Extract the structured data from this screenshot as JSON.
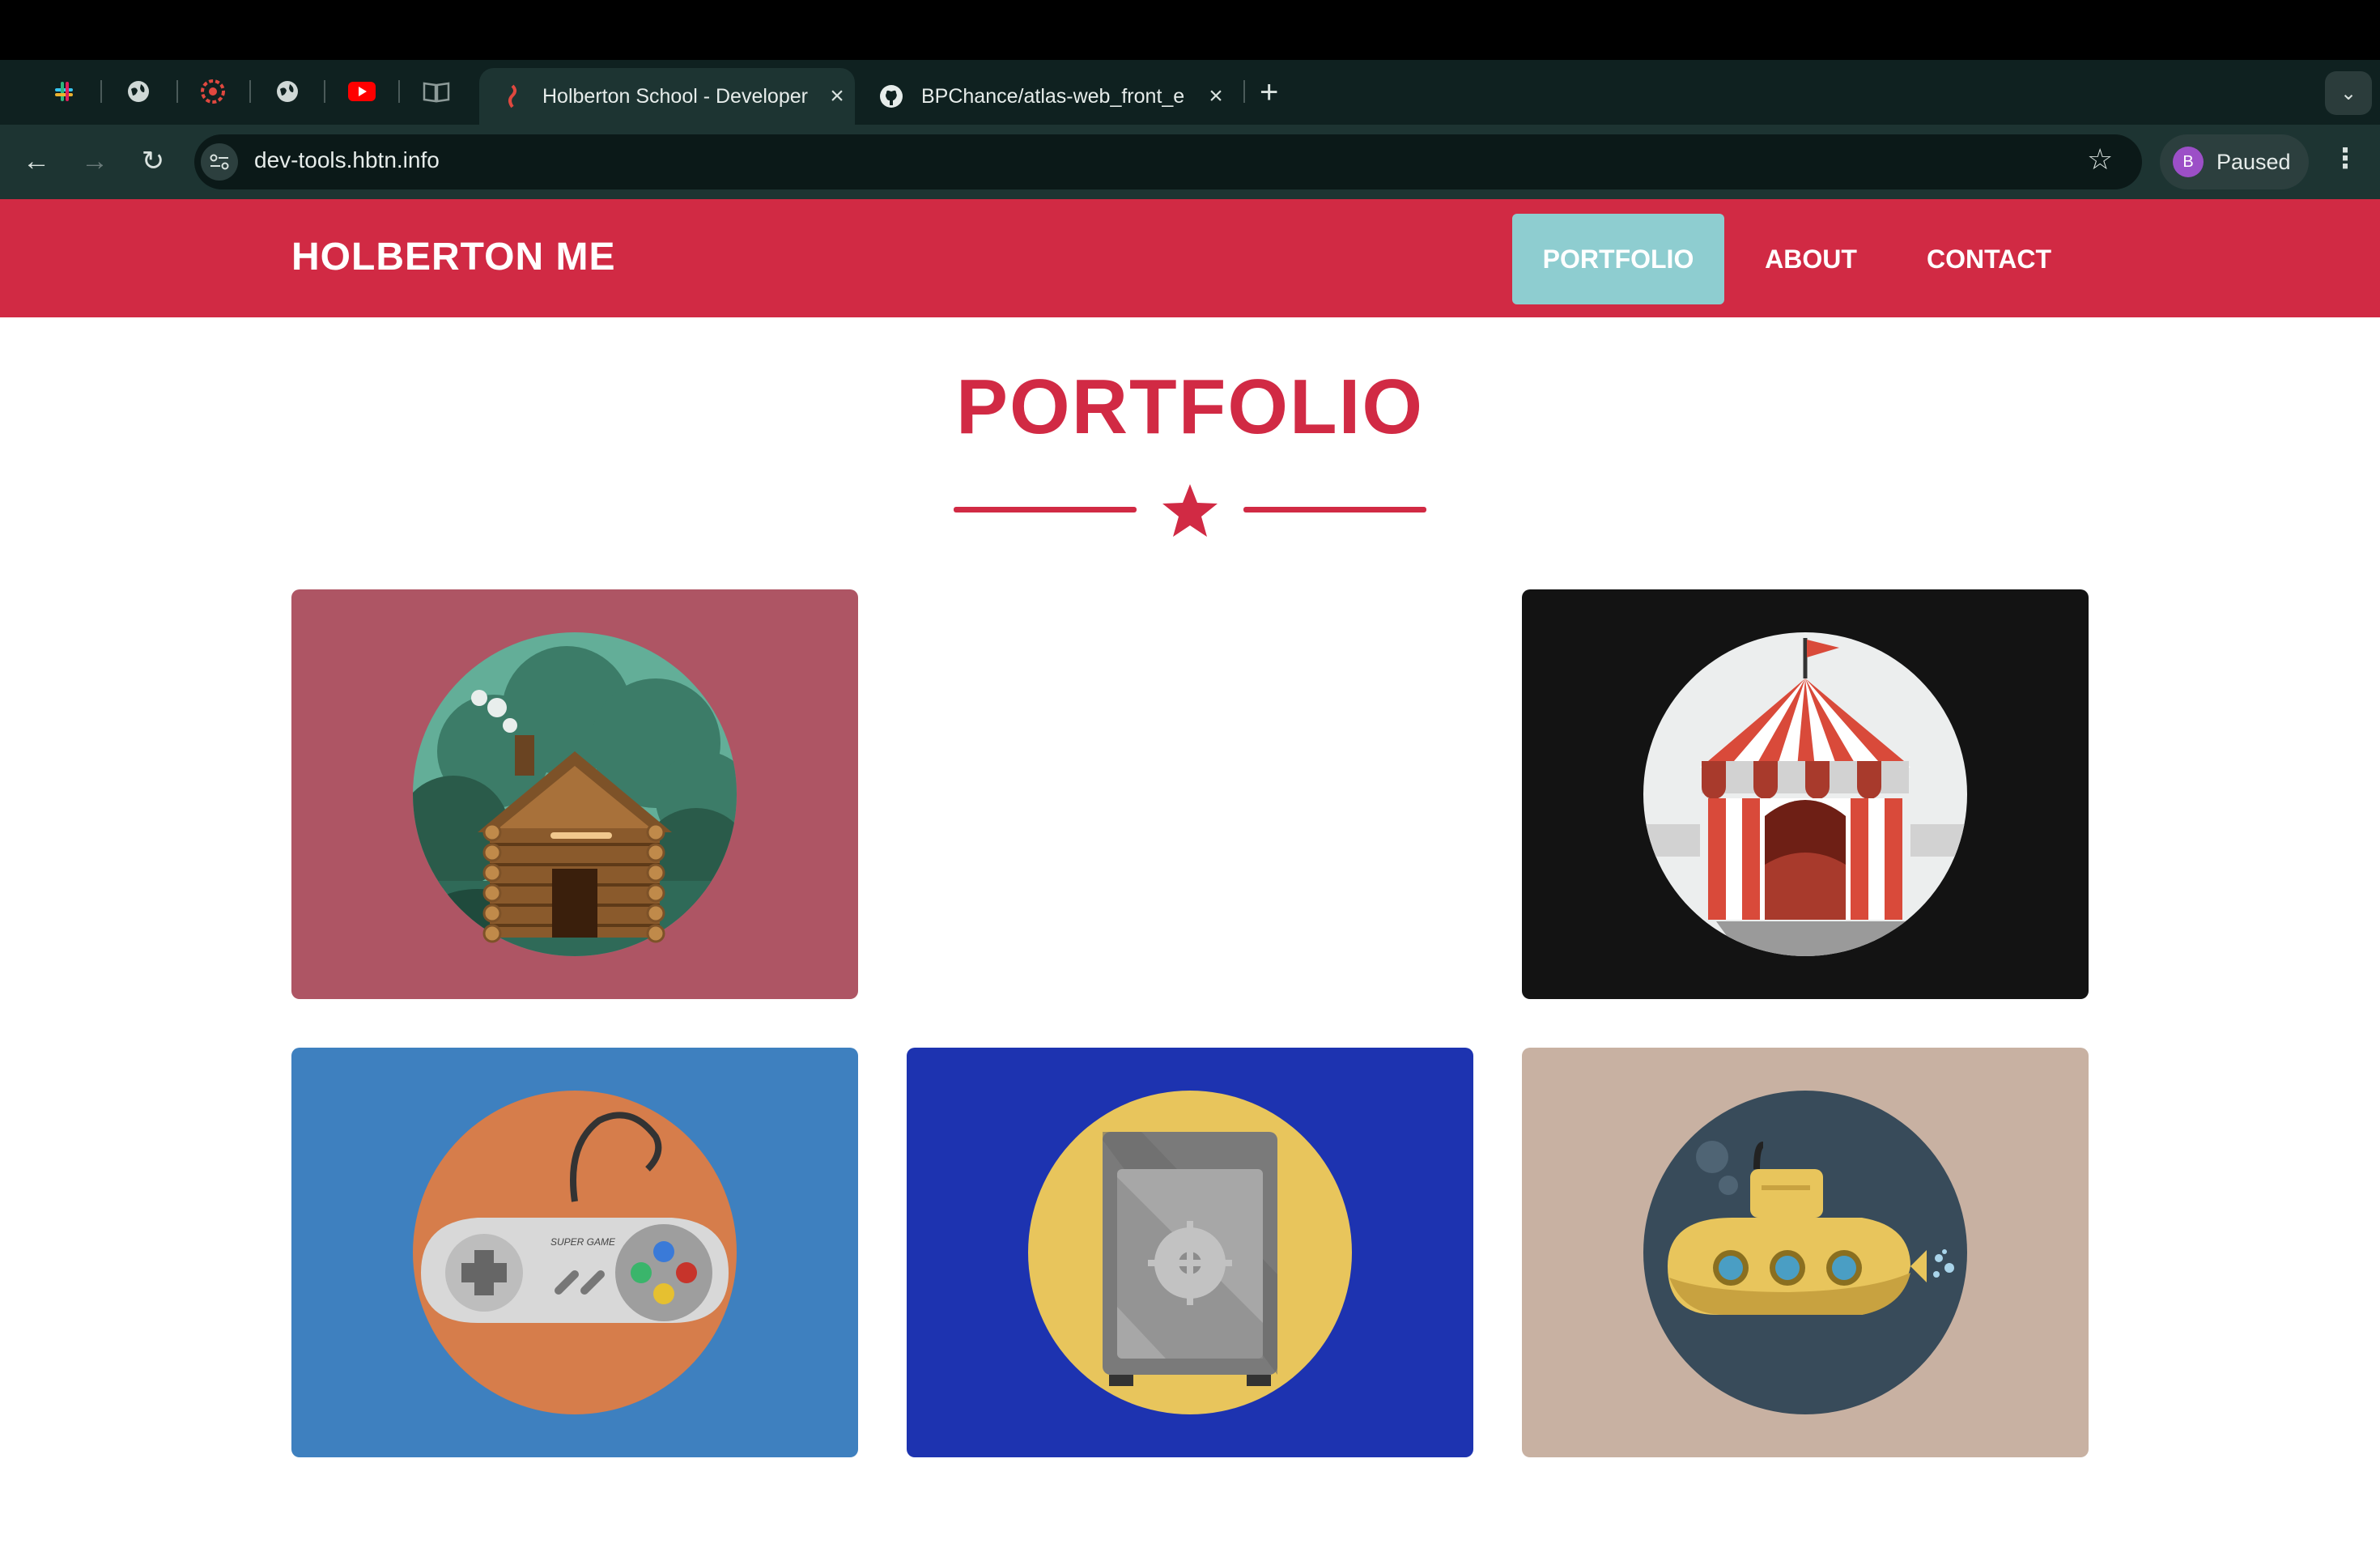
{
  "browser": {
    "tabs": [
      {
        "title": "Holberton School - Developer",
        "active": true
      },
      {
        "title": "BPChance/atlas-web_front_e",
        "active": false
      }
    ],
    "url": "dev-tools.hbtn.info",
    "profile_initial": "B",
    "profile_status": "Paused"
  },
  "site": {
    "brand": "HOLBERTON ME",
    "nav": [
      {
        "label": "PORTFOLIO",
        "active": true
      },
      {
        "label": "ABOUT",
        "active": false
      },
      {
        "label": "CONTACT",
        "active": false
      }
    ],
    "heading": "PORTFOLIO",
    "accent_color": "#d12a44",
    "nav_active_color": "#8ecdd0"
  },
  "portfolio": {
    "items": [
      {
        "icon": "cabin-icon",
        "bg": "#ae5564"
      },
      {
        "icon": "empty",
        "bg": "#ffffff"
      },
      {
        "icon": "circus-tent-icon",
        "bg": "#131313"
      },
      {
        "icon": "game-controller-icon",
        "bg": "#3e80bf",
        "text": "SUPER GAME"
      },
      {
        "icon": "safe-icon",
        "bg": "#1d33b0"
      },
      {
        "icon": "submarine-icon",
        "bg": "#c8b1a2"
      }
    ]
  }
}
